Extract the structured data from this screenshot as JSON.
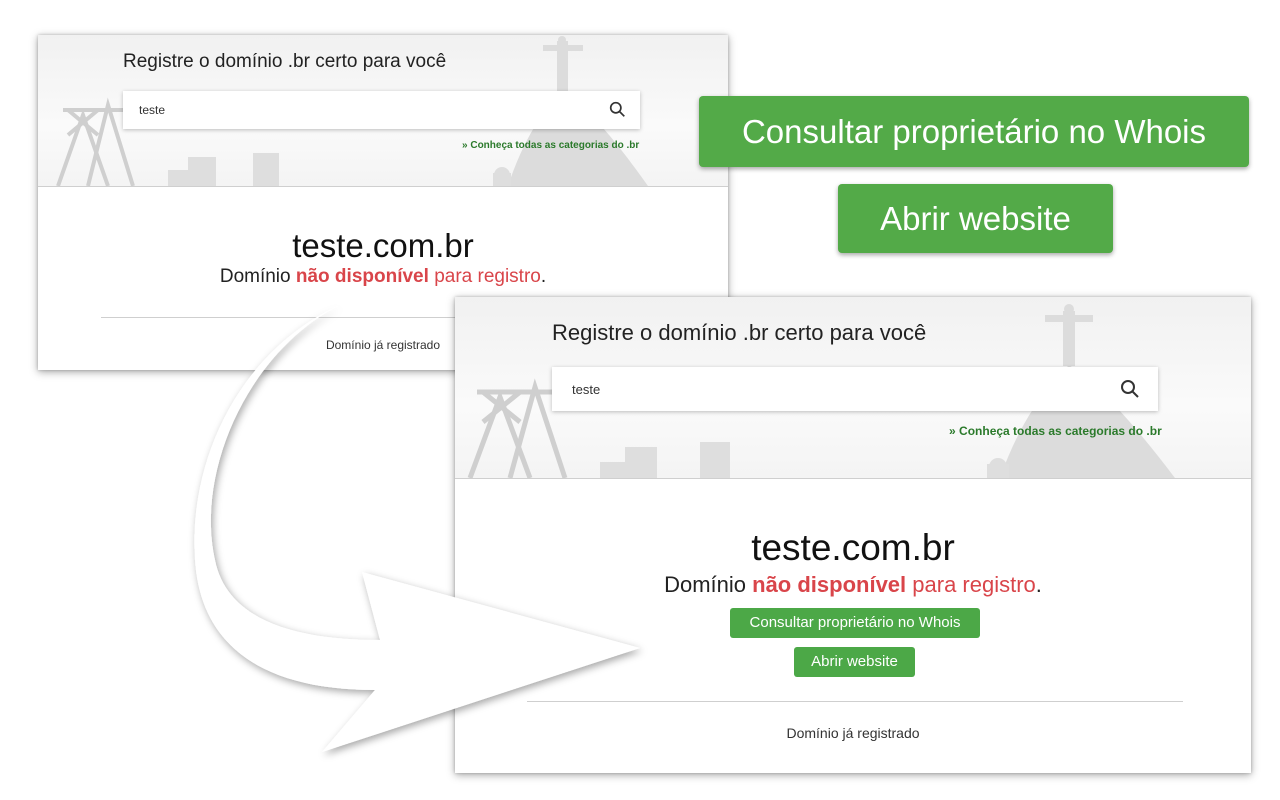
{
  "register_title": "Registre o domínio .br certo para você",
  "search": {
    "value": "teste"
  },
  "categories_link": "Conheça todas as categorias do .br",
  "categories_prefix": "»",
  "result": {
    "domain": "teste.com.br",
    "status_word": "Domínio",
    "status_highlight": "não disponível",
    "status_suffix": "para registro",
    "status_period": "."
  },
  "whois_button": "Consultar proprietário no Whois",
  "website_button": "Abrir website",
  "footnote": "Domínio já registrado",
  "colors": {
    "green": "#4ca847",
    "red": "#d9454a",
    "link_green": "#2b7a2b"
  },
  "icons": [
    "search-icon",
    "curved-arrow-icon"
  ]
}
